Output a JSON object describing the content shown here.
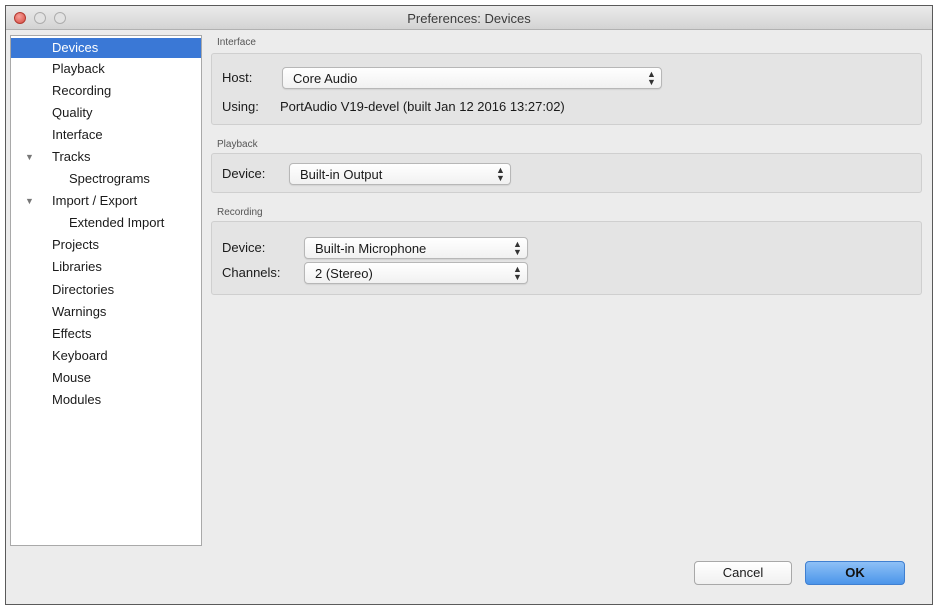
{
  "window": {
    "title": "Preferences: Devices"
  },
  "sidebar": {
    "items": [
      {
        "label": "Devices",
        "selected": true
      },
      {
        "label": "Playback"
      },
      {
        "label": "Recording"
      },
      {
        "label": "Quality"
      },
      {
        "label": "Interface"
      },
      {
        "label": "Tracks",
        "expanded": true
      },
      {
        "label": "Spectrograms"
      },
      {
        "label": "Import / Export",
        "expanded": true
      },
      {
        "label": "Extended Import"
      },
      {
        "label": "Projects"
      },
      {
        "label": "Libraries"
      },
      {
        "label": "Directories"
      },
      {
        "label": "Warnings"
      },
      {
        "label": "Effects"
      },
      {
        "label": "Keyboard"
      },
      {
        "label": "Mouse"
      },
      {
        "label": "Modules"
      }
    ],
    "disclosure_glyph": "▼"
  },
  "interface": {
    "group_label": "Interface",
    "host_label": "Host:",
    "host_value": "Core Audio",
    "using_label": "Using:",
    "using_value": "PortAudio V19-devel (built Jan 12 2016 13:27:02)"
  },
  "playback": {
    "group_label": "Playback",
    "device_label": "Device:",
    "device_value": "Built-in Output"
  },
  "recording": {
    "group_label": "Recording",
    "device_label": "Device:",
    "device_value": "Built-in Microphone",
    "channels_label": "Channels:",
    "channels_value": "2 (Stereo)"
  },
  "buttons": {
    "cancel": "Cancel",
    "ok": "OK"
  },
  "icons": {
    "popup_arrows": "updown-arrows-icon",
    "disclosure": "disclosure-triangle-icon"
  },
  "colors": {
    "selection": "#3a78d6",
    "ok_button": "#4b95ea"
  }
}
